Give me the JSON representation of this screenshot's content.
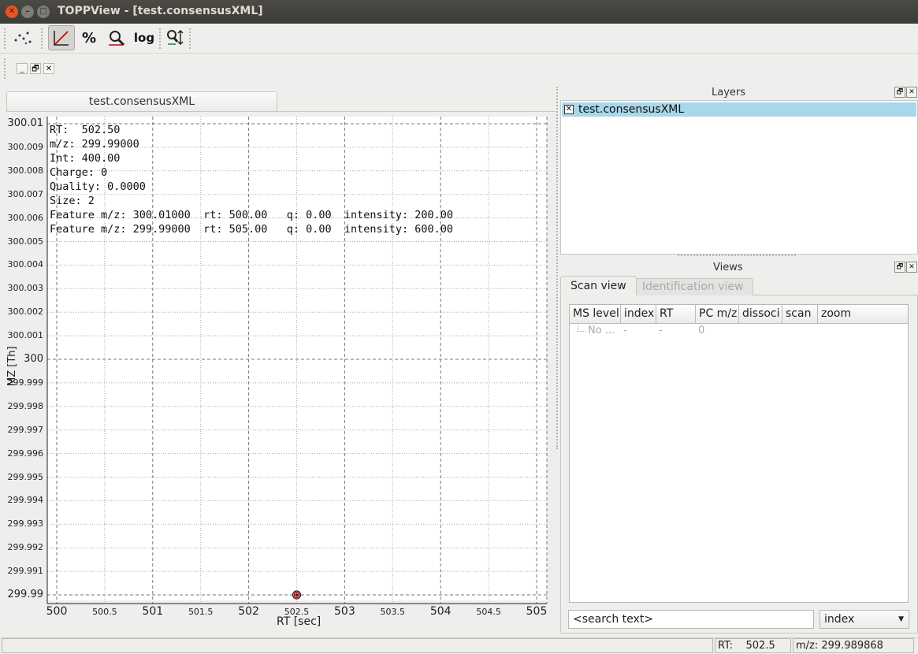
{
  "window": {
    "title": "TOPPView - [test.consensusXML]"
  },
  "document_tab": {
    "label": "test.consensusXML"
  },
  "plot": {
    "y_label": "MZ [Th]",
    "x_label": "RT [sec]",
    "y_ticks_major": [
      "300.01",
      "300",
      "299.99"
    ],
    "y_ticks_minor": [
      "300.009",
      "300.008",
      "300.007",
      "300.006",
      "300.005",
      "300.004",
      "300.003",
      "300.002",
      "300.001",
      "299.999",
      "299.998",
      "299.997",
      "299.996",
      "299.995",
      "299.994",
      "299.993",
      "299.992",
      "299.991"
    ],
    "x_ticks_major": [
      "500",
      "501",
      "502",
      "503",
      "504",
      "505"
    ],
    "x_ticks_minor": [
      "500.5",
      "501.5",
      "502.5",
      "503.5",
      "504.5"
    ],
    "info_lines": [
      "RT:  502.50",
      "m/z: 299.99000",
      "Int: 400.00",
      "Charge: 0",
      "Quality: 0.0000",
      "Size: 2",
      "Feature m/z: 300.01000  rt: 500.00   q: 0.00  intensity: 200.00",
      "Feature m/z: 299.99000  rt: 505.00   q: 0.00  intensity: 600.00"
    ],
    "feature_point": {
      "rt": 502.5,
      "mz": 299.99
    },
    "marker_color": "#cc0000"
  },
  "layers_dock": {
    "title": "Layers",
    "items": [
      {
        "label": "test.consensusXML",
        "checked": true
      }
    ]
  },
  "views_dock": {
    "title": "Views",
    "tabs": [
      "Scan view",
      "Identification view"
    ],
    "table": {
      "columns": [
        "MS level",
        "index",
        "RT",
        "PC m/z",
        "dissoci",
        "scan",
        "zoom"
      ],
      "row": [
        "No ...",
        "-",
        "-",
        "0"
      ]
    },
    "search_placeholder": "<search text>",
    "search_field": "index"
  },
  "status": {
    "rt": "RT:    502.5",
    "mz": "m/z: 299.989868"
  },
  "colors": {
    "layer_selected": "#a9d7ea",
    "titlebar": "#3c3b37",
    "close_button": "#e95420"
  }
}
